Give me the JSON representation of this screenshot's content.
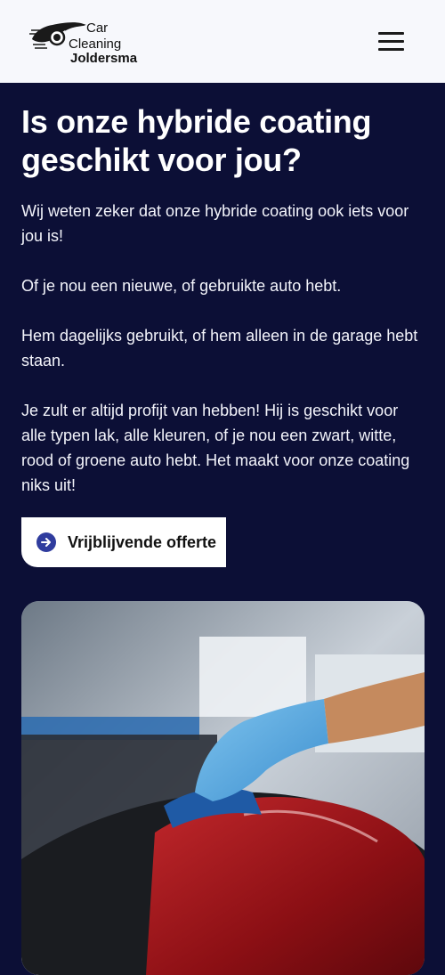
{
  "header": {
    "logo": {
      "line1": "Car",
      "line2": "Cleaning",
      "line3": "Joldersma"
    },
    "menu_icon": "hamburger-menu-icon"
  },
  "main": {
    "title": "Is onze hybride coating geschikt voor jou?",
    "paragraphs": [
      "Wij weten zeker dat onze hybride coating ook iets voor jou is!",
      "Of je nou een nieuwe, of gebruikte auto hebt.",
      "Hem dagelijks gebruikt, of hem alleen in de garage hebt staan.",
      "Je zult er altijd profijt van hebben! Hij is geschikt voor alle typen lak, alle kleuren, of je nou een zwart, witte, rood of groene auto hebt. Het maakt voor onze coating niks uit!"
    ],
    "cta": {
      "label": "Vrijblijvende offerte",
      "icon": "arrow-right-circle-icon"
    },
    "photo": {
      "subject": "gloved hand applying coating to red car"
    }
  },
  "colors": {
    "background": "#0c0f36",
    "header": "#f7f8fc",
    "accent": "#2f3c9e"
  }
}
